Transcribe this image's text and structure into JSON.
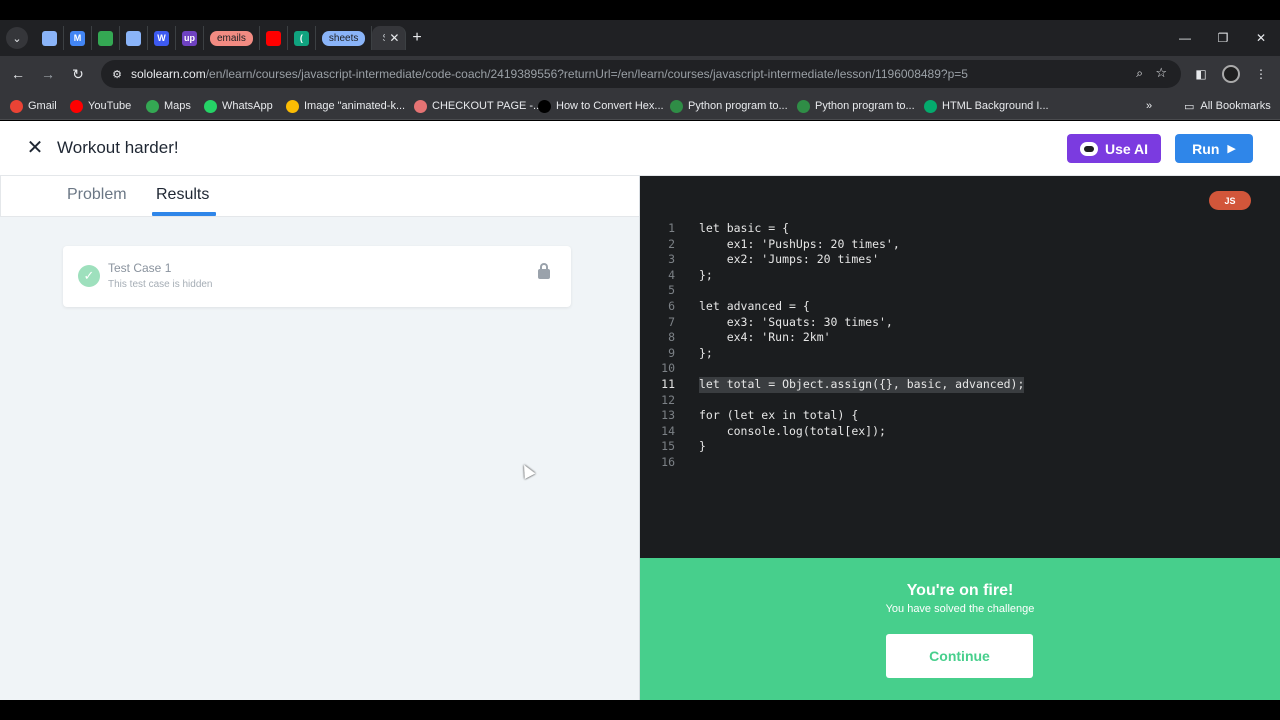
{
  "browser": {
    "tabs": [
      {
        "icon": "dropdown-icon",
        "label": "",
        "color": "#8ab4f8"
      },
      {
        "icon": "m-logo-icon",
        "label": "M",
        "color": "#4285f4"
      },
      {
        "icon": "play-store-icon",
        "label": "",
        "color": "#34a853"
      },
      {
        "icon": "record-icon",
        "label": "",
        "color": "#8ab4f8"
      },
      {
        "icon": "w-logo-icon",
        "label": "W",
        "color": "#3d5af1"
      },
      {
        "icon": "upwork-icon",
        "label": "up",
        "color": "#6f42c1"
      },
      {
        "icon": "youtube-icon",
        "label": "",
        "color": "#ff0000"
      },
      {
        "icon": "chatgpt-icon",
        "label": "(",
        "color": "#10a37f"
      }
    ],
    "tab_groups": [
      {
        "label": "emails",
        "color": "#f28b82"
      },
      {
        "label": "sheets",
        "color": "#8ab4f8"
      }
    ],
    "active_tab": {
      "label": "S",
      "close": "✕"
    },
    "url_domain": "sololearn.com",
    "url_path": "/en/learn/courses/javascript-intermediate/code-coach/2419389556?returnUrl=/en/learn/courses/javascript-intermediate/lesson/1196008489?p=5",
    "bookmarks": [
      {
        "label": "Gmail",
        "icon": "gmail-icon",
        "color": "#ea4335"
      },
      {
        "label": "YouTube",
        "icon": "youtube-icon",
        "color": "#ff0000"
      },
      {
        "label": "Maps",
        "icon": "maps-icon",
        "color": "#34a853"
      },
      {
        "label": "WhatsApp",
        "icon": "whatsapp-icon",
        "color": "#25d366"
      },
      {
        "label": "Image \"animated-k...",
        "icon": "star-icon",
        "color": "#fbbc04"
      },
      {
        "label": "CHECKOUT PAGE -...",
        "icon": "lips-icon",
        "color": "#e57373"
      },
      {
        "label": "How to Convert Hex...",
        "icon": "alpha-icon",
        "color": "#000000"
      },
      {
        "label": "Python program to...",
        "icon": "gfg-icon",
        "color": "#2f8d46"
      },
      {
        "label": "Python program to...",
        "icon": "gfg-icon",
        "color": "#2f8d46"
      },
      {
        "label": "HTML Background I...",
        "icon": "w-icon",
        "color": "#04aa6d"
      }
    ],
    "bookmarks_more": "»",
    "all_bookmarks": "All Bookmarks"
  },
  "header": {
    "title": "Workout harder!",
    "use_ai": "Use AI",
    "run": "Run"
  },
  "left_panel": {
    "tabs": [
      "Problem",
      "Results"
    ],
    "active_tab": "Results",
    "test_case": {
      "name": "Test Case 1",
      "status": "This test case is hidden"
    }
  },
  "editor": {
    "language": "JS",
    "current_line": 11,
    "lines": [
      "let basic = {",
      "    ex1: 'PushUps: 20 times',",
      "    ex2: 'Jumps: 20 times'",
      "};",
      "",
      "let advanced = {",
      "    ex3: 'Squats: 30 times',",
      "    ex4: 'Run: 2km'",
      "};",
      "",
      "let total = Object.assign({}, basic, advanced);",
      "",
      "for (let ex in total) {",
      "    console.log(total[ex]);",
      "}",
      ""
    ]
  },
  "success": {
    "title": "You're on fire!",
    "subtitle": "You have solved the challenge",
    "continue": "Continue"
  },
  "colors": {
    "accent_blue": "#2f86e9",
    "ai_purple": "#7b3be0",
    "success_green": "#47cf8c",
    "editor_bg": "#1b1d1f",
    "js_badge": "#d2563a"
  }
}
